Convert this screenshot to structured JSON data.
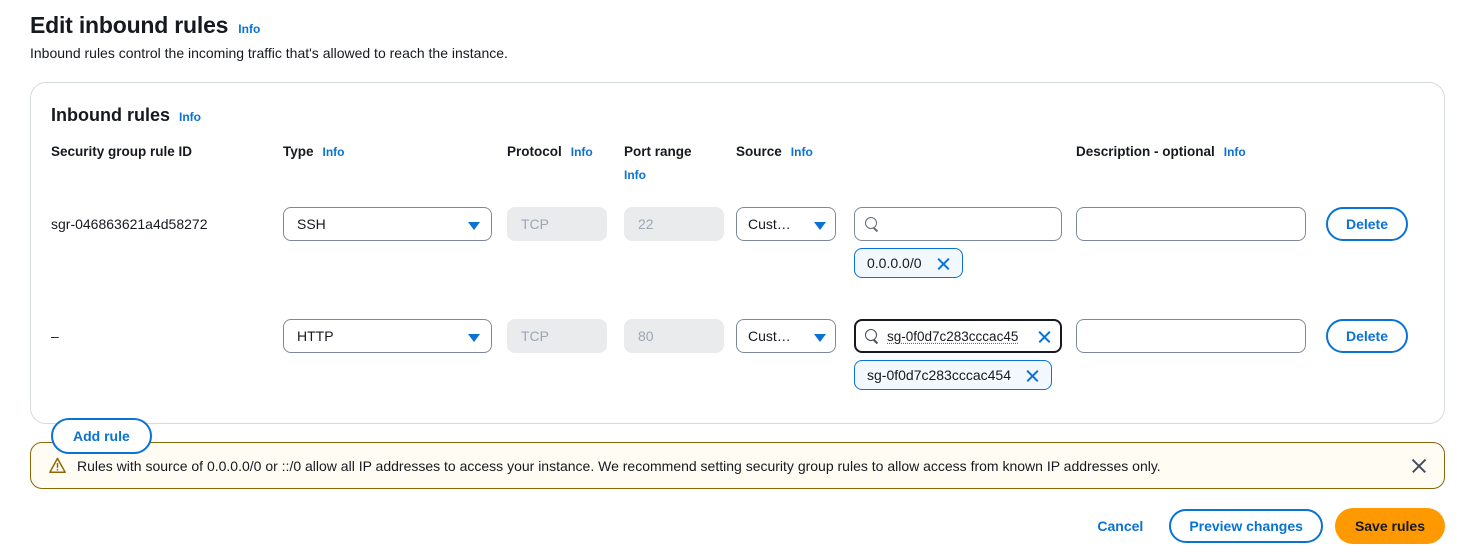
{
  "header": {
    "title": "Edit inbound rules",
    "info_label": "Info",
    "description": "Inbound rules control the incoming traffic that's allowed to reach the instance."
  },
  "panel": {
    "title": "Inbound rules",
    "info_label": "Info",
    "columns": {
      "rule_id": "Security group rule ID",
      "type": "Type",
      "type_info": "Info",
      "protocol": "Protocol",
      "protocol_info": "Info",
      "port_range": "Port range",
      "port_range_info": "Info",
      "source": "Source",
      "source_info": "Info",
      "description": "Description - optional",
      "description_info": "Info"
    },
    "rows": [
      {
        "rule_id": "sgr-046863621a4d58272",
        "type": "SSH",
        "protocol": "TCP",
        "port_range": "22",
        "source_type": "Cust…",
        "source_search_value": "",
        "source_focused": false,
        "source_has_clear": false,
        "tokens": [
          "0.0.0.0/0"
        ],
        "description": "",
        "delete_label": "Delete"
      },
      {
        "rule_id": "–",
        "type": "HTTP",
        "protocol": "TCP",
        "port_range": "80",
        "source_type": "Cust…",
        "source_search_value": "sg-0f0d7c283cccac45",
        "source_focused": true,
        "source_has_clear": true,
        "tokens": [
          "sg-0f0d7c283cccac454"
        ],
        "description": "",
        "delete_label": "Delete"
      }
    ],
    "add_rule_label": "Add rule"
  },
  "alert": {
    "icon": "warning-triangle-icon",
    "text": "Rules with source of 0.0.0.0/0 or ::/0 allow all IP addresses to access your instance. We recommend setting security group rules to allow access from known IP addresses only.",
    "close_label": "Dismiss"
  },
  "footer": {
    "cancel_label": "Cancel",
    "preview_label": "Preview changes",
    "save_label": "Save rules"
  },
  "colors": {
    "link_blue": "#0972d3",
    "save_orange": "#ff9900",
    "warning_border": "#8d6605",
    "warning_bg": "#fffdf3",
    "token_bg": "#f2f8fd",
    "disabled_bg": "#e9ebed",
    "panel_border": "#d5dbdb",
    "spellcheck_red": "#e8372a"
  },
  "inputs": {
    "description_placeholder": "",
    "search_placeholder": ""
  }
}
